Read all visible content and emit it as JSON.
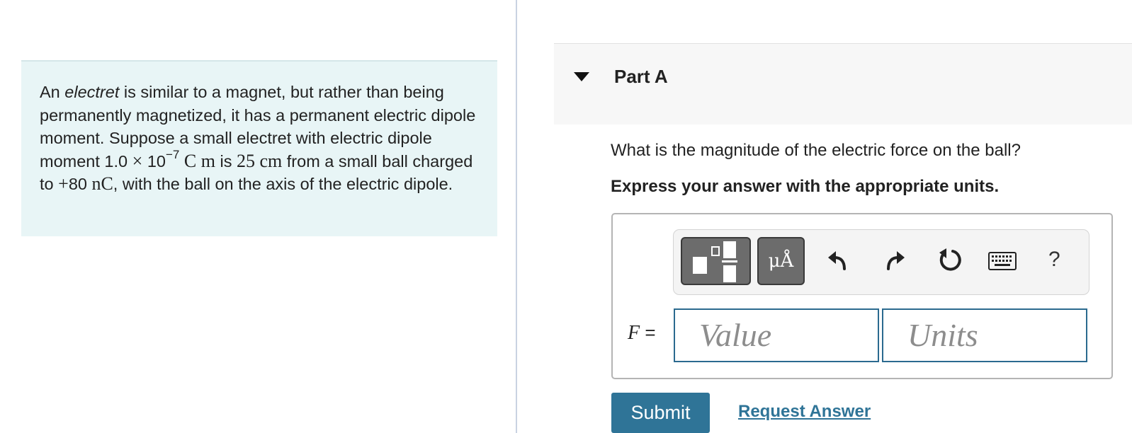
{
  "problem": {
    "text_1": "An ",
    "italic_word": "electret",
    "text_2": " is similar to a magnet, but rather than being permanently magnetized, it has a permanent electric dipole moment. Suppose a small electret with electric dipole moment 1.0 ",
    "times": "×",
    "base": " 10",
    "exponent": "−7",
    "dipole_unit": " C m",
    "text_3": " is ",
    "distance": "25 cm",
    "text_4": " from a small ball charged to ",
    "charge_sign": "+",
    "charge_value": "80",
    "charge_unit": " nC",
    "text_5": ", with the ball on the axis of the electric dipole."
  },
  "part": {
    "title": "Part A",
    "question": "What is the magnitude of the electric force on the ball?",
    "instruction": "Express your answer with the appropriate units."
  },
  "toolbar": {
    "units_button_label": "μÅ",
    "help_label": "?",
    "icons": [
      "templates-icon",
      "units-icon",
      "undo-icon",
      "redo-icon",
      "reset-icon",
      "keyboard-icon",
      "help-icon"
    ]
  },
  "answer": {
    "variable": "F",
    "equals": " =",
    "value_placeholder": "Value",
    "units_placeholder": "Units"
  },
  "actions": {
    "submit_label": "Submit",
    "request_answer_label": "Request Answer"
  },
  "colors": {
    "accent": "#2f7497",
    "problem_bg": "#e8f5f6",
    "field_border": "#2b6a8f"
  }
}
